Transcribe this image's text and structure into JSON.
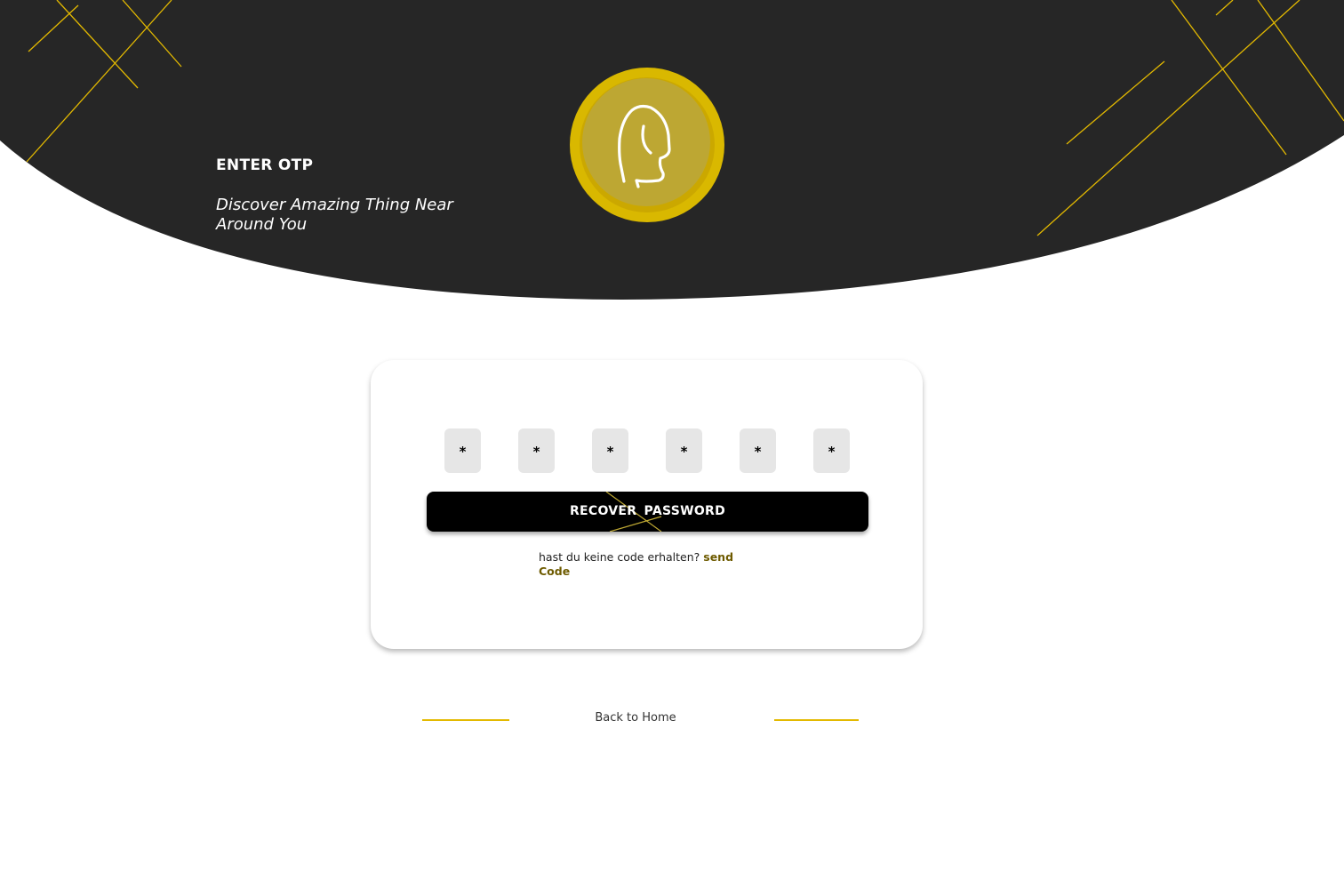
{
  "colors": {
    "hero_background": "#262626",
    "accent": "#e3b900",
    "logo_gold": "#bda733",
    "link_color": "#6e5b00",
    "otp_box": "#e6e6e6",
    "button": "#000000"
  },
  "hero": {
    "title": "ENTER OTP",
    "subtitle": "Discover Amazing Thing Near Around You"
  },
  "logo": {
    "icon": "head-silhouette-icon"
  },
  "otp": {
    "digits": [
      "*",
      "*",
      "*",
      "*",
      "*",
      "*"
    ]
  },
  "recover_button": {
    "label": "RECOVER  PASSWORD"
  },
  "resend": {
    "prompt": "hast du keine code erhalten?",
    "link": "send Code"
  },
  "footer": {
    "back_home": "Back to Home"
  }
}
